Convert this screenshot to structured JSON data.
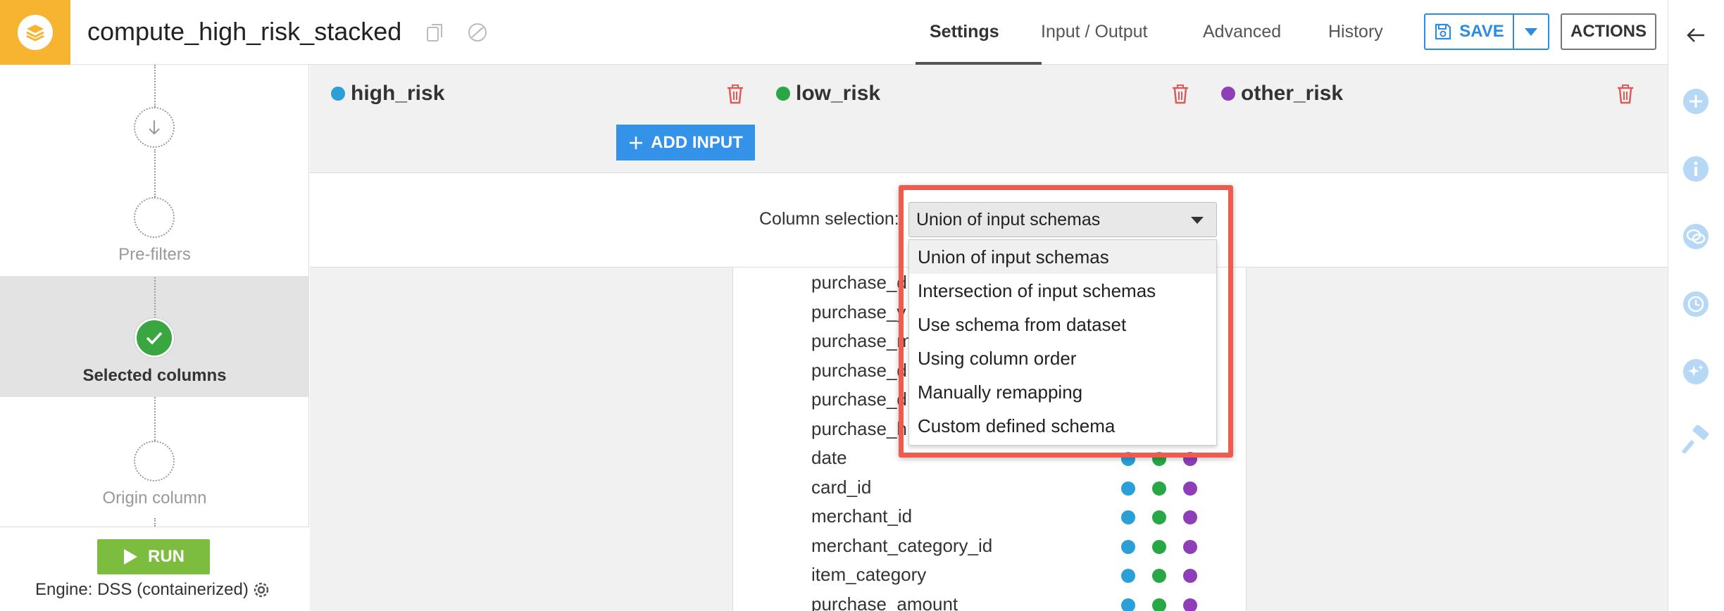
{
  "header": {
    "recipe_name": "compute_high_risk_stacked",
    "tabs": [
      {
        "label": "Settings",
        "active": true
      },
      {
        "label": "Input / Output"
      },
      {
        "label": "Advanced"
      },
      {
        "label": "History"
      }
    ],
    "save_label": "SAVE",
    "actions_label": "ACTIONS"
  },
  "left": {
    "steps": [
      {
        "label": "Pre-filters"
      },
      {
        "label": "Selected columns",
        "selected": true
      },
      {
        "label": "Origin column"
      }
    ],
    "run_label": "RUN",
    "engine_label": "Engine: DSS (containerized)"
  },
  "inputs": [
    {
      "name": "high_risk",
      "color": "#2a9fd8"
    },
    {
      "name": "low_risk",
      "color": "#27a845"
    },
    {
      "name": "other_risk",
      "color": "#8e3fb8"
    }
  ],
  "add_input_label": "ADD INPUT",
  "column_selection": {
    "label": "Column selection:",
    "selected": "Union of input schemas",
    "options": [
      "Union of input schemas",
      "Intersection of input schemas",
      "Use schema from dataset",
      "Using column order",
      "Manually remapping",
      "Custom defined schema"
    ]
  },
  "columns": [
    "purchase_d",
    "purchase_y",
    "purchase_m",
    "purchase_d",
    "purchase_d",
    "purchase_h",
    "date",
    "card_id",
    "merchant_id",
    "merchant_category_id",
    "item_category",
    "purchase_amount"
  ],
  "colors": {
    "accent": "#2d8cdf",
    "brand": "#f7b431",
    "run": "#7cbd3f",
    "highlight": "#ef5b4c"
  }
}
